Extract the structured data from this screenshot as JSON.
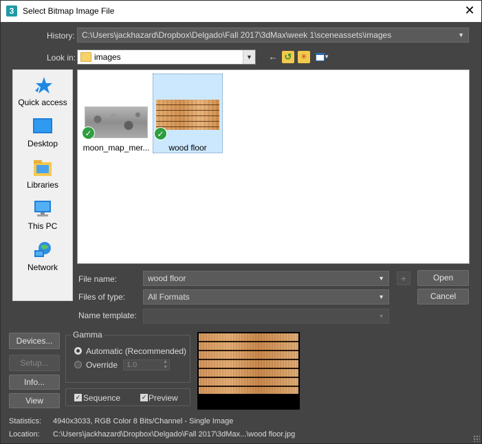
{
  "window": {
    "app_icon": "3",
    "title": "Select Bitmap Image File",
    "close_glyph": "✕"
  },
  "history": {
    "label": "History:",
    "value": "C:\\Users\\jackhazard\\Dropbox\\Delgado\\Fall 2017\\3dMax\\week 1\\sceneassets\\images"
  },
  "lookin": {
    "label": "Look in:",
    "value": "images",
    "icon": "folder-icon"
  },
  "toolbar": {
    "back_icon": "back-arrow-icon",
    "up_icon": "up-folder-icon",
    "new_folder_icon": "new-folder-icon",
    "view_menu_icon": "view-menu-icon"
  },
  "places": [
    {
      "label": "Quick access",
      "icon": "star-icon"
    },
    {
      "label": "Desktop",
      "icon": "desktop-icon"
    },
    {
      "label": "Libraries",
      "icon": "libraries-icon"
    },
    {
      "label": "This PC",
      "icon": "computer-icon"
    },
    {
      "label": "Network",
      "icon": "network-icon"
    }
  ],
  "files": [
    {
      "name": "moon_map_mer...",
      "selected": false,
      "thumbnail": "moon-map-thumbnail"
    },
    {
      "name": "wood floor",
      "selected": true,
      "thumbnail": "wood-floor-thumbnail"
    }
  ],
  "form": {
    "file_name_label": "File name:",
    "file_name_value": "wood floor",
    "files_of_type_label": "Files of type:",
    "files_of_type_value": "All Formats",
    "name_template_label": "Name template:",
    "name_template_value": "",
    "plus_label": "+"
  },
  "buttons": {
    "open": "Open",
    "cancel": "Cancel",
    "devices": "Devices...",
    "setup": "Setup...",
    "info": "Info...",
    "view": "View"
  },
  "gamma": {
    "title": "Gamma",
    "automatic_label": "Automatic (Recommended)",
    "override_label": "Override",
    "override_value": "1.0",
    "selected": "automatic"
  },
  "options": {
    "sequence_label": "Sequence",
    "sequence_checked": true,
    "preview_label": "Preview",
    "preview_checked": true
  },
  "statistics": {
    "label": "Statistics:",
    "value": "4940x3033, RGB Color 8 Bits/Channel - Single Image"
  },
  "location": {
    "label": "Location:",
    "value": "C:\\Users\\jackhazard\\Dropbox\\Delgado\\Fall 2017\\3dMax...\\wood floor.jpg"
  },
  "colors": {
    "background": "#444444",
    "selection": "#cce8ff",
    "check_green": "#2e9e3f"
  }
}
